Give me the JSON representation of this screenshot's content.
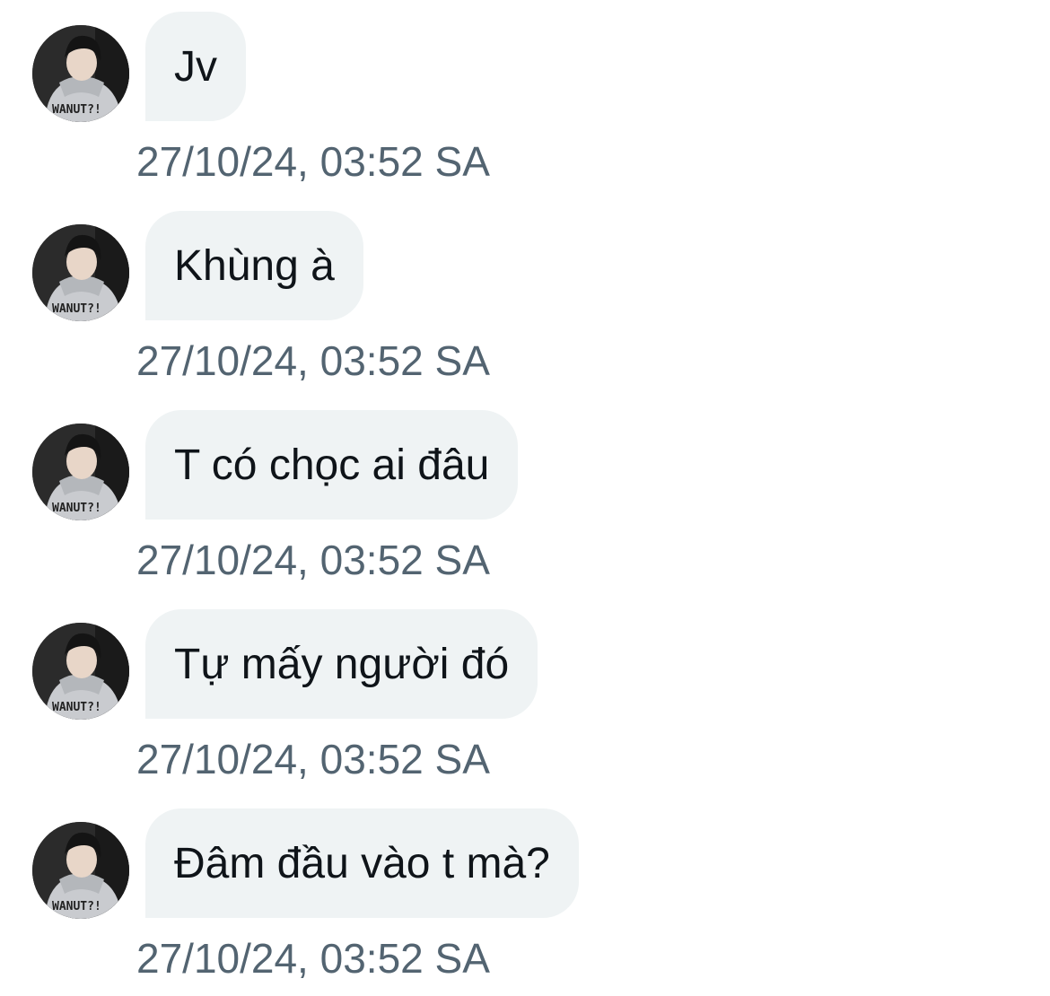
{
  "messages": [
    {
      "text": "Jv",
      "timestamp": "27/10/24, 03:52 SA"
    },
    {
      "text": "Khùng à",
      "timestamp": "27/10/24, 03:52 SA"
    },
    {
      "text": "T có chọc ai đâu",
      "timestamp": "27/10/24, 03:52 SA"
    },
    {
      "text": "Tự mấy người đó",
      "timestamp": "27/10/24, 03:52 SA"
    },
    {
      "text": "Đâm đầu vào t mà?",
      "timestamp": "27/10/24, 03:52 SA"
    }
  ],
  "avatar": {
    "hoodie_print": "WANUT?!"
  },
  "colors": {
    "bubble_bg": "#eff3f4",
    "text": "#0f1419",
    "timestamp": "#536471",
    "avatar_bg": "#2b2b2b"
  }
}
